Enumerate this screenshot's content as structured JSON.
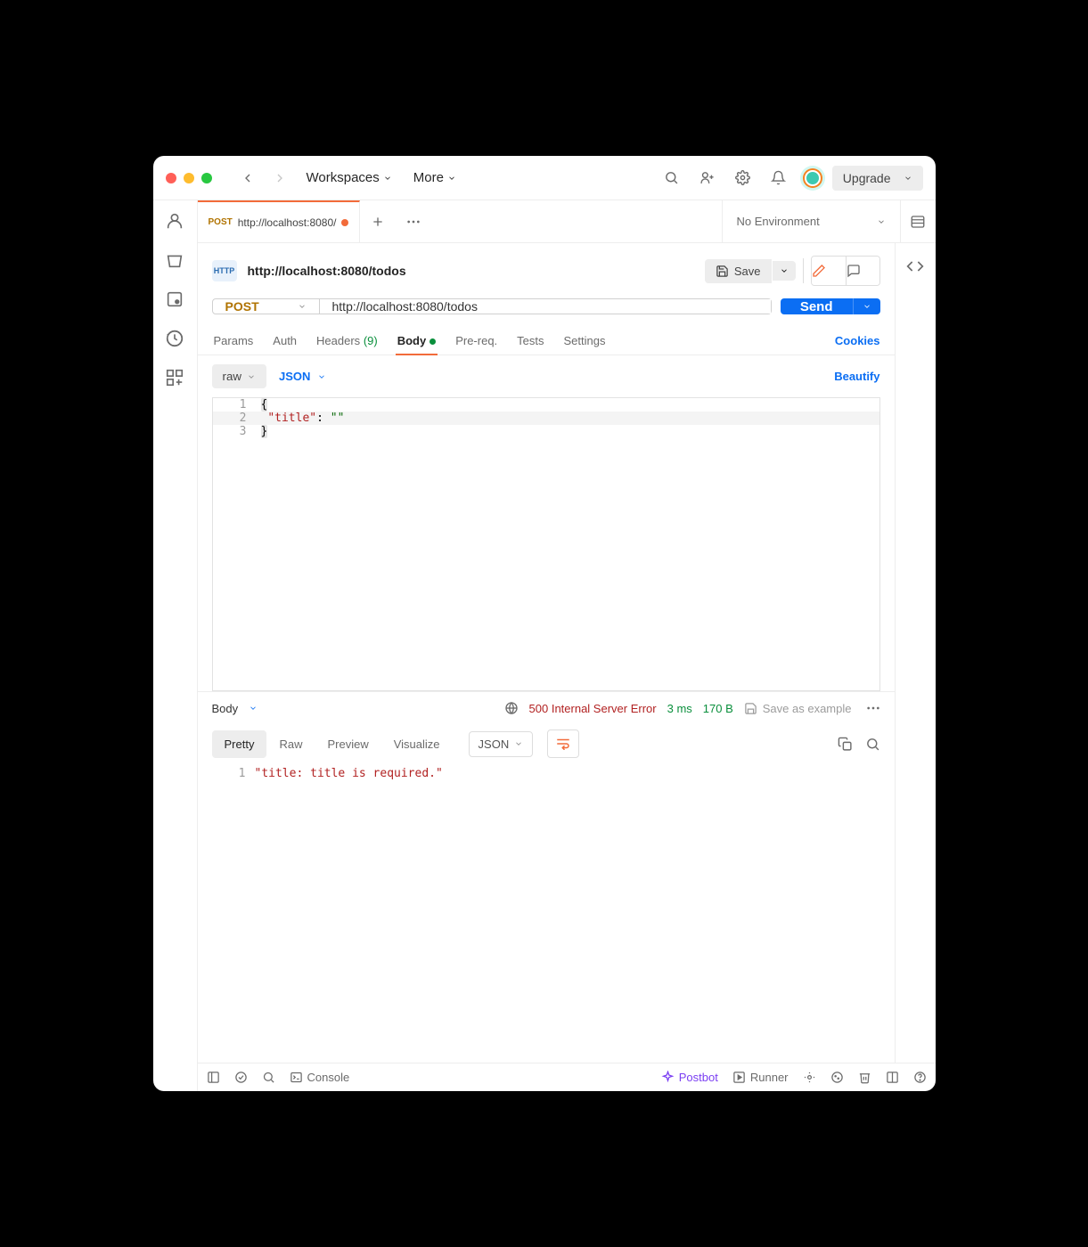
{
  "titlebar": {
    "workspaces": "Workspaces",
    "more": "More",
    "upgrade": "Upgrade"
  },
  "tab": {
    "method": "POST",
    "title": "http://localhost:8080/",
    "env": "No Environment"
  },
  "request": {
    "title": "http://localhost:8080/todos",
    "save": "Save",
    "method": "POST",
    "url": "http://localhost:8080/todos",
    "send": "Send",
    "tabs": {
      "params": "Params",
      "auth": "Auth",
      "headers": "Headers",
      "headers_count": "(9)",
      "body": "Body",
      "prereq": "Pre-req.",
      "tests": "Tests",
      "settings": "Settings"
    },
    "cookies": "Cookies",
    "raw": "raw",
    "json": "JSON",
    "beautify": "Beautify",
    "editor": {
      "l1": "{",
      "l2a": "\"title\"",
      "l2b": ":",
      "l2c": "\"\"",
      "l3": "}"
    }
  },
  "response": {
    "bodylabel": "Body",
    "status": "500 Internal Server Error",
    "time": "3 ms",
    "size": "170 B",
    "saveas": "Save as example",
    "tabs": {
      "pretty": "Pretty",
      "raw": "Raw",
      "preview": "Preview",
      "visualize": "Visualize"
    },
    "json": "JSON",
    "body_text": "\"title: title is required.\""
  },
  "footer": {
    "console": "Console",
    "postbot": "Postbot",
    "runner": "Runner"
  }
}
